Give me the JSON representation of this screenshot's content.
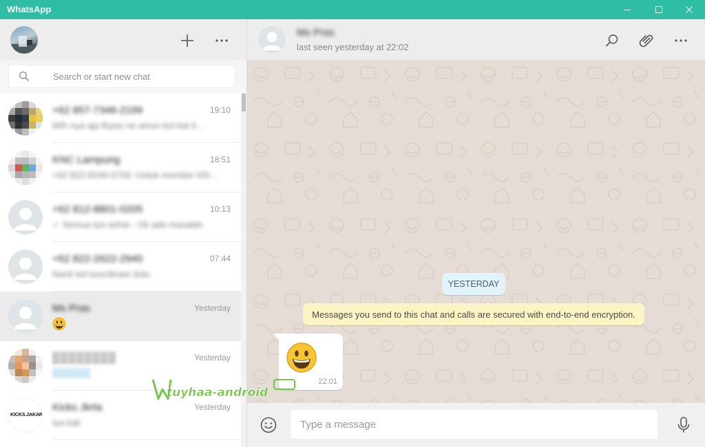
{
  "window": {
    "title": "WhatsApp",
    "accent_color": "#2fbea4",
    "controls": [
      "minimize-icon",
      "maximize-icon",
      "close-icon"
    ]
  },
  "sidebar": {
    "header_icons": [
      "new-chat-plus-icon",
      "menu-dots-icon"
    ],
    "search": {
      "placeholder": "Search or start new chat",
      "icon": "search-icon"
    },
    "chats": [
      {
        "name": "+62 857-7346-2199",
        "time": "19:10",
        "preview": "Wih nya aja fbyoo ne amun koi kat ti ...",
        "avatar": "pixelated-photo",
        "active": false
      },
      {
        "name": "KNC Lampung",
        "time": "18:51",
        "preview": "+62 822-8240-0700: Untuk member KN...",
        "avatar": "pixelated-photo",
        "active": false
      },
      {
        "name": "+62 812-8801-0205",
        "time": "10:13",
        "preview": "✓ Semua tya sehat - Ok ada masalah.",
        "avatar": "default",
        "active": false
      },
      {
        "name": "+62 822-2622-2940",
        "time": "07:44",
        "preview": "Nanti kel koordinasi dulu",
        "avatar": "default",
        "active": false
      },
      {
        "name": "Ms Pras",
        "time": "Yesterday",
        "preview": "😀",
        "avatar": "default",
        "active": true
      },
      {
        "name": "████████",
        "time": "Yesterday",
        "preview": "██████",
        "avatar": "pixelated-photo",
        "active": false
      },
      {
        "name": "Kicks Jkrta",
        "time": "Yesterday",
        "preview": "Iya kak",
        "avatar": "KICKS.JAKARTA",
        "active": false
      }
    ]
  },
  "conversation": {
    "contact_name": "Ms Pras",
    "contact_status": "last seen yesterday at 22:02",
    "header_icons": [
      "search-icon",
      "attach-paperclip-icon",
      "menu-dots-icon"
    ],
    "date_chip": "YESTERDAY",
    "encryption_notice": "Messages you send to this chat and calls are secured with end-to-end encryption.",
    "messages": [
      {
        "content": "😀",
        "time": "22:01",
        "direction": "incoming"
      }
    ],
    "background_color": "#e5ddd5"
  },
  "composer": {
    "placeholder": "Type a message",
    "left_icon": "emoji-icon",
    "right_icon": "microphone-icon"
  },
  "watermark": {
    "text": "tuyhaa-android"
  }
}
